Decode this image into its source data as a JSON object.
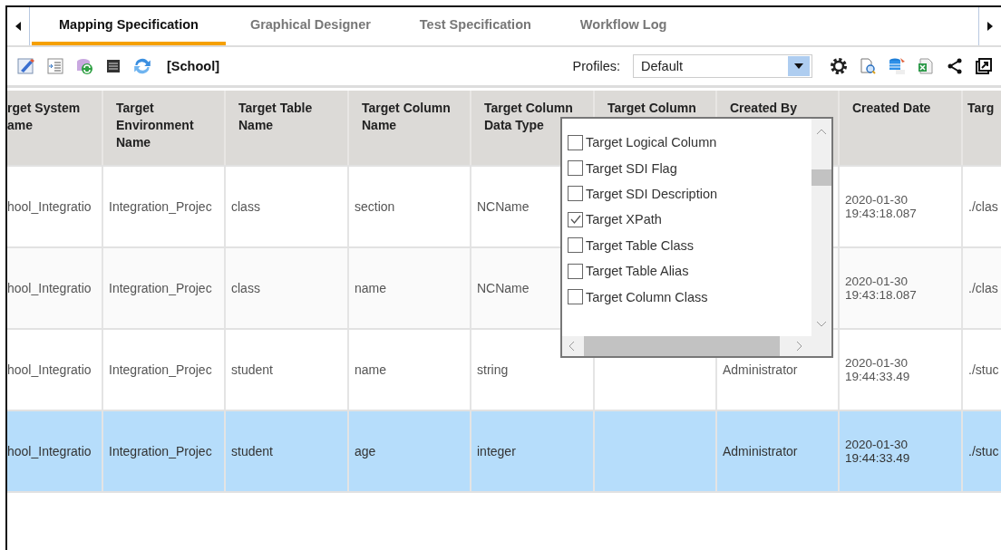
{
  "tabs": [
    {
      "label": "Mapping Specification",
      "selected": true
    },
    {
      "label": "Graphical Designer",
      "selected": false
    },
    {
      "label": "Test Specification",
      "selected": false
    },
    {
      "label": "Workflow Log",
      "selected": false
    }
  ],
  "toolbar": {
    "title": "[School]",
    "profiles_label": "Profiles:",
    "profile_value": "Default"
  },
  "table": {
    "columns": [
      "rget System\name",
      "Target\nEnvironment\nName",
      "Target Table\nName",
      "Target Column\nName",
      "Target Column\nData Type",
      "Target Column",
      "Created By",
      "Created Date",
      "Targ"
    ],
    "rows": [
      {
        "selected": false,
        "cells": [
          "hool_Integratio",
          "Integration_Projec",
          "class",
          "section",
          "NCName",
          null,
          null,
          "2020-01-30 19:43:18.087",
          "./clas"
        ]
      },
      {
        "selected": false,
        "cells": [
          "hool_Integratio",
          "Integration_Projec",
          "class",
          "name",
          "NCName",
          null,
          null,
          "2020-01-30 19:43:18.087",
          "./clas"
        ]
      },
      {
        "selected": false,
        "cells": [
          "hool_Integratio",
          "Integration_Projec",
          "student",
          "name",
          "string",
          null,
          "Administrator",
          "2020-01-30 19:44:33.49",
          "./stuc"
        ]
      },
      {
        "selected": true,
        "cells": [
          "hool_Integratio",
          "Integration_Projec",
          "student",
          "age",
          "integer",
          null,
          "Administrator",
          "2020-01-30 19:44:33.49",
          "./stuc"
        ]
      }
    ]
  },
  "column_chooser": {
    "items": [
      {
        "label": "Target Logical Column",
        "checked": false
      },
      {
        "label": "Target SDI Flag",
        "checked": false
      },
      {
        "label": "Target SDI Description",
        "checked": false
      },
      {
        "label": "Target XPath",
        "checked": true
      },
      {
        "label": "Target Table Class",
        "checked": false
      },
      {
        "label": "Target Table Alias",
        "checked": false
      },
      {
        "label": "Target Column Class",
        "checked": false
      }
    ]
  }
}
